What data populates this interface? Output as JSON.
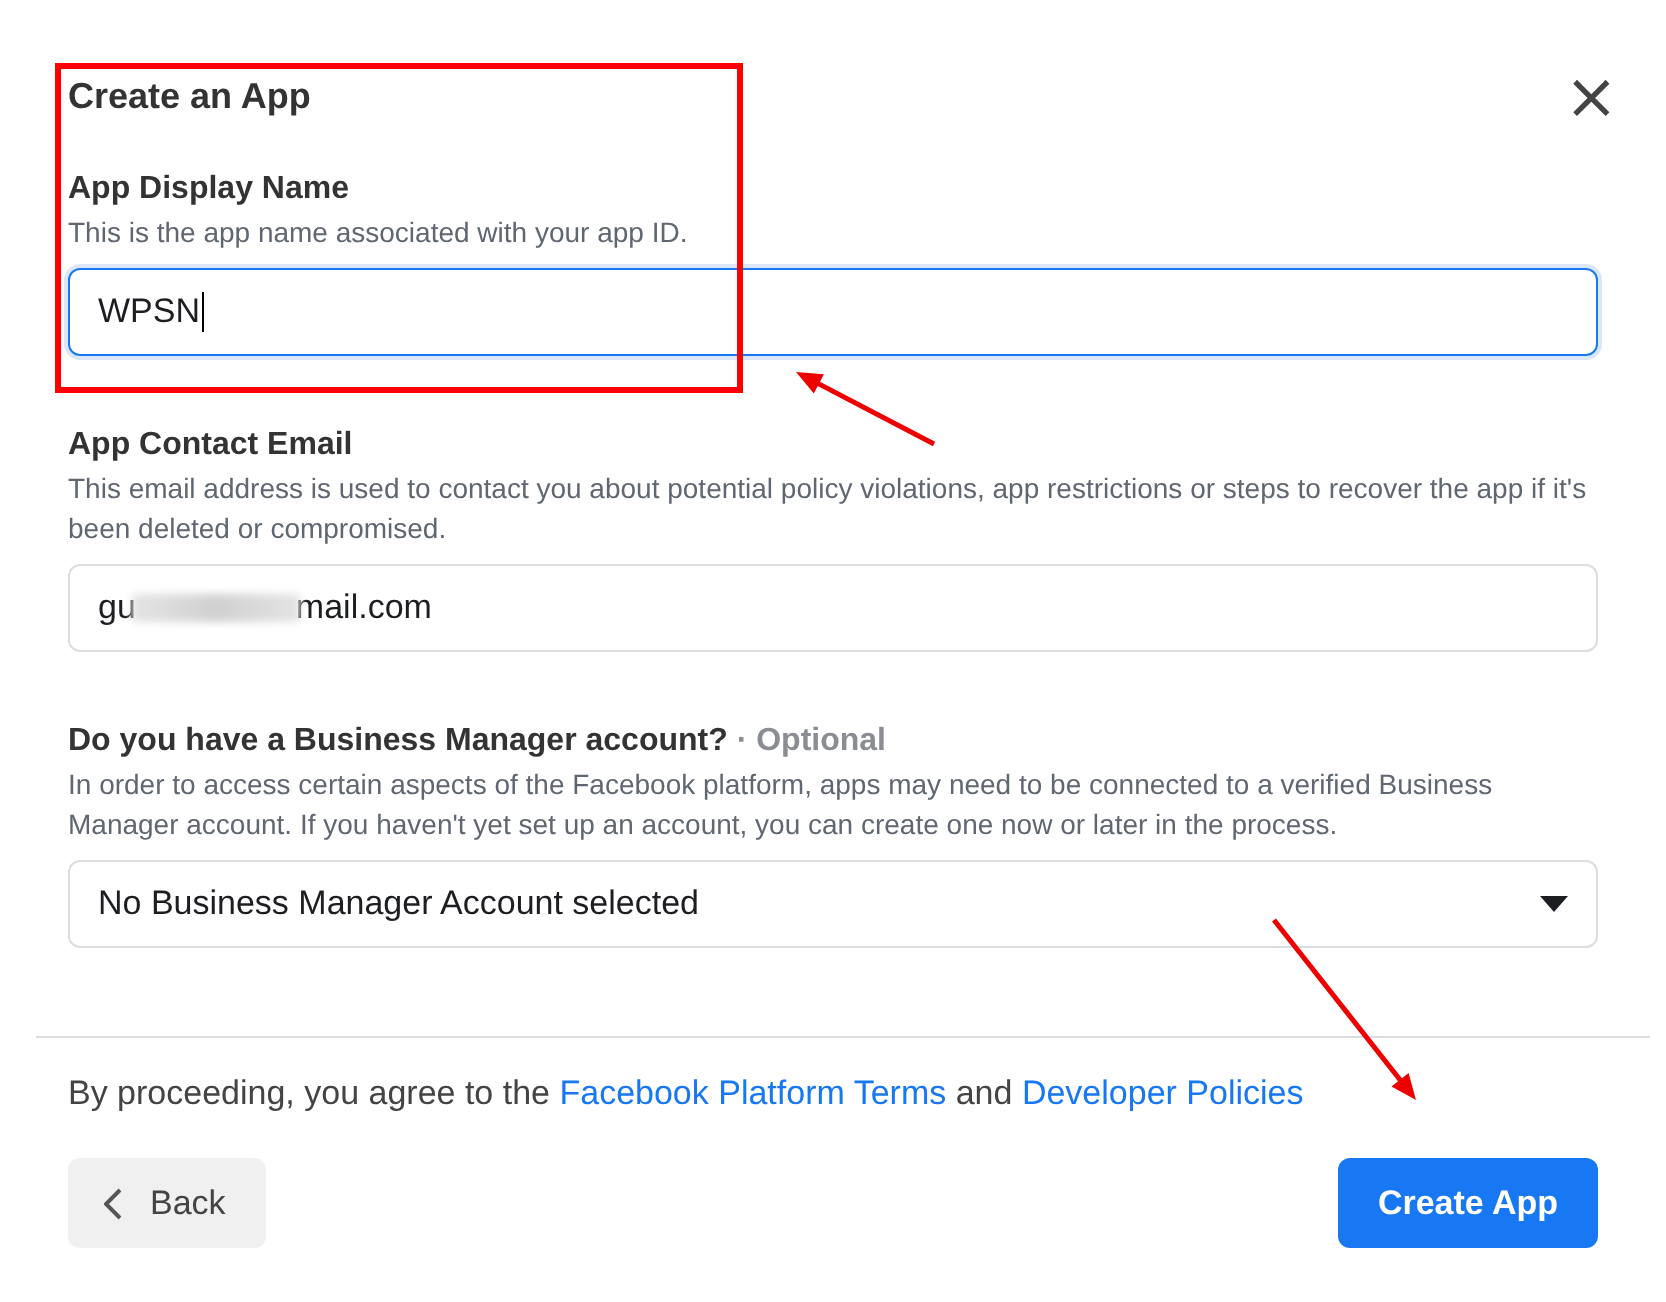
{
  "dialog": {
    "title": "Create an App",
    "close": "×"
  },
  "fields": [
    {
      "kind": "text",
      "label": "App Display Name",
      "help": "This is the app name associated with your app ID.",
      "value": "WPSN",
      "focused": true
    },
    {
      "kind": "redacted",
      "label": "App Contact Email",
      "help": "This email address is used to contact you about potential policy violations, app restrictions or steps to recover the app if it's been deleted or compromised.",
      "value_start": "gu",
      "value_end": "mail.com",
      "focused": false
    },
    {
      "kind": "select",
      "label": "Do you have a Business Manager account?",
      "optional": "· Optional",
      "help": "In order to access certain aspects of the Facebook platform, apps may need to be connected to a verified Business Manager account. If you haven't yet set up an account, you can create one now or later in the process.",
      "value": "No Business Manager Account selected",
      "focused": false
    }
  ],
  "footer": {
    "notice_start": "By proceeding, you agree to the",
    "link_1": "Facebook Platform Terms",
    "notice_middle": "and",
    "link_2": "Developer Policies"
  },
  "buttons": [
    {
      "kind": "back",
      "label": "Back"
    },
    {
      "kind": "primary",
      "label": "Create App"
    }
  ],
  "annotations": [
    {
      "kind": "frame"
    },
    {
      "kind": "arrow_up_left"
    },
    {
      "kind": "arrow_down_right"
    }
  ]
}
